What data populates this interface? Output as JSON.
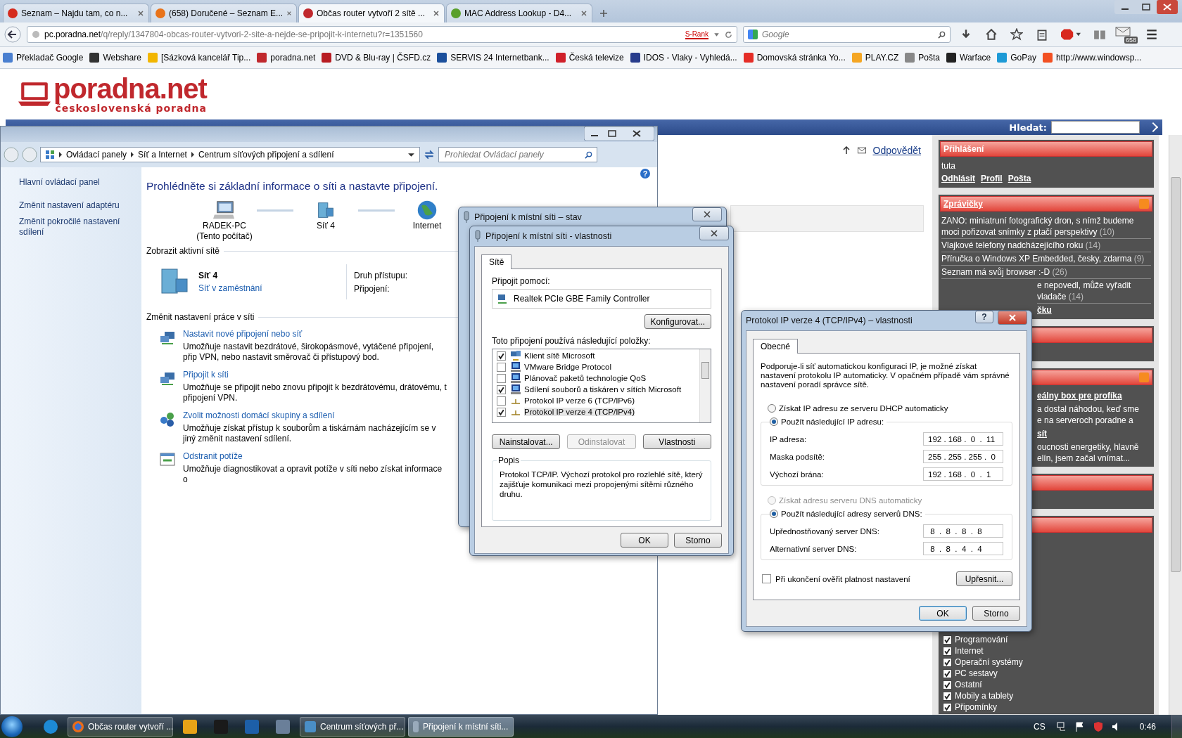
{
  "browser": {
    "tabs": [
      {
        "title": "Seznam – Najdu tam, co n...",
        "selected": false,
        "color": "#d52b1e"
      },
      {
        "title": "(658) Doručené – Seznam E...",
        "selected": false,
        "color": "#e8731a"
      },
      {
        "title": "Občas router vytvoří 2 sítě ...",
        "selected": true,
        "color": "#c0282d"
      },
      {
        "title": "MAC Address Lookup - D4...",
        "selected": false,
        "color": "#5aa02c"
      }
    ],
    "url_host": "pc.poradna.net",
    "url_path": "/q/reply/1347804-obcas-router-vytvori-2-site-a-nejde-se-pripojit-k-internetu?r=1351560",
    "rank": "S-Rank",
    "search_placeholder": "Google",
    "mail_count": "658",
    "bookmarks": [
      {
        "label": "Překladač Google",
        "color": "#4a7fd0"
      },
      {
        "label": "Webshare",
        "color": "#333333"
      },
      {
        "label": "[Sázková kancelář Tip...",
        "color": "#f2b600"
      },
      {
        "label": "poradna.net",
        "color": "#c0282d"
      },
      {
        "label": "DVD & Blu-ray | ČSFD.cz",
        "color": "#b81c22"
      },
      {
        "label": "SERVIS 24 Internetbank...",
        "color": "#1b4f9c"
      },
      {
        "label": "Česká televize",
        "color": "#d0202a"
      },
      {
        "label": "IDOS - Vlaky - Vyhledá...",
        "color": "#283c8c"
      },
      {
        "label": "Domovská stránka Yo...",
        "color": "#e52d27"
      },
      {
        "label": "PLAY.CZ",
        "color": "#f5a623"
      },
      {
        "label": "Pošta",
        "color": "#888888"
      },
      {
        "label": "Warface",
        "color": "#222222"
      },
      {
        "label": "GoPay",
        "color": "#1d9ad6"
      },
      {
        "label": "http://www.windowsp...",
        "color": "#f25022"
      }
    ]
  },
  "site": {
    "logo": "poradna.net",
    "tagline": "československá poradna",
    "search_label": "Hledat:",
    "reply_link": "Odpovědět"
  },
  "sidebar": {
    "login": {
      "title": "Přihlášení",
      "user": "tuta",
      "links": [
        "Odhlásit",
        "Profil",
        "Pošta"
      ]
    },
    "news": {
      "title": "Zprávičky",
      "items": [
        {
          "text": "ZANO: miniatruní fotografický dron, s nímž budeme moci pořizovat snímky z ptačí perspektivy",
          "count": "(10)",
          "partial": false
        },
        {
          "text": "Vlajkové telefony nadcházejícího roku",
          "count": "(14)",
          "partial": false
        },
        {
          "text": "Příručka o Windows XP Embedded, česky, zdarma",
          "count": "(9)",
          "partial": false
        },
        {
          "text": "Seznam má svůj browser :-D",
          "count": "(26)",
          "partial": false
        },
        {
          "text": "e nepovedl, může vyřadit vladače",
          "count": "(14)",
          "partial": true
        }
      ],
      "more": "čku"
    },
    "articles": {
      "items": [
        {
          "kind": "title",
          "text": "eálny box pre profíka"
        },
        {
          "kind": "text",
          "text": "a dostal náhodou, keď sme"
        },
        {
          "kind": "text",
          "text": "e na serveroch poradne a"
        },
        {
          "kind": "title",
          "text": "sít"
        },
        {
          "kind": "text",
          "text": "oucnosti energetiky, hlavně"
        },
        {
          "kind": "text",
          "text": "elín, jsem začal vnímat..."
        }
      ]
    },
    "categories": [
      {
        "label": "Programování",
        "checked": true
      },
      {
        "label": "Internet",
        "checked": true
      },
      {
        "label": "Operační systémy",
        "checked": true
      },
      {
        "label": "PC sestavy",
        "checked": true
      },
      {
        "label": "Ostatní",
        "checked": true
      },
      {
        "label": "Mobily a tablety",
        "checked": true
      },
      {
        "label": "Připomínky",
        "checked": true
      }
    ]
  },
  "control_panel": {
    "breadcrumb": [
      "Ovládací panely",
      "Síť a Internet",
      "Centrum síťových připojení a sdílení"
    ],
    "search_placeholder": "Prohledat Ovládací panely",
    "left_links": [
      "Hlavní ovládací panel",
      "Změnit nastavení adaptéru",
      "Změnit pokročilé nastavení sdílení"
    ],
    "help": "?",
    "heading": "Prohlédněte si základní informace o síti a nastavte připojení.",
    "map": [
      {
        "kind": "computer",
        "label": "RADEK-PC",
        "sub": "(Tento počítač)"
      },
      {
        "kind": "network",
        "label": "Síť  4"
      },
      {
        "kind": "globe",
        "label": "Internet"
      }
    ],
    "active_title": "Zobrazit aktivní sítě",
    "network_name": "Síť  4",
    "network_type": "Síť v zaměstnání",
    "access_label": "Druh přístupu:",
    "connection_label": "Připojení:",
    "change_title": "Změnit nastavení práce v síti",
    "tasks": [
      {
        "kind": "setup",
        "title": "Nastavit nové připojení nebo síť",
        "desc": "Umožňuje nastavit bezdrátové, širokopásmové, vytáčené připojení, přip VPN, nebo nastavit směrovač či přístupový bod."
      },
      {
        "kind": "connect",
        "title": "Připojit k síti",
        "desc": "Umožňuje se připojit nebo znovu připojit k bezdrátovému, drátovému, t připojení VPN."
      },
      {
        "kind": "homegroup",
        "title": "Zvolit možnosti domácí skupiny a sdílení",
        "desc": "Umožňuje získat přístup k souborům a tiskárnám nacházejícím se v jiný změnit nastavení sdílení."
      },
      {
        "kind": "troubleshoot",
        "title": "Odstranit potíže",
        "desc": "Umožňuje diagnostikovat a opravit potíže v síti nebo získat informace o"
      }
    ]
  },
  "status_dialog": {
    "title": "Připojení k místní síti – stav"
  },
  "properties_dialog": {
    "title": "Připojení k místní síti - vlastnosti",
    "tab": "Sítě",
    "connect_label": "Připojit pomocí:",
    "adapter": "Realtek PCIe GBE Family Controller",
    "configure": "Konfigurovat...",
    "items_label": "Toto připojení používá následující položky:",
    "items": [
      {
        "kind": "client",
        "label": "Klient sítě Microsoft",
        "checked": true,
        "selected": false
      },
      {
        "kind": "service",
        "label": "VMware Bridge Protocol",
        "checked": false,
        "selected": false
      },
      {
        "kind": "service",
        "label": "Plánovač paketů technologie QoS",
        "checked": false,
        "selected": false
      },
      {
        "kind": "service",
        "label": "Sdílení souborů a tiskáren v sítích Microsoft",
        "checked": true,
        "selected": false
      },
      {
        "kind": "protocol",
        "label": "Protokol IP verze 6 (TCP/IPv6)",
        "checked": false,
        "selected": false
      },
      {
        "kind": "protocol",
        "label": "Protokol IP verze 4 (TCP/IPv4)",
        "checked": true,
        "selected": true
      }
    ],
    "buttons": [
      {
        "label": "Nainstalovat...",
        "disabled": false
      },
      {
        "label": "Odinstalovat",
        "disabled": true
      },
      {
        "label": "Vlastnosti",
        "disabled": false
      }
    ],
    "desc_title": "Popis",
    "desc": "Protokol TCP/IP. Výchozí protokol pro rozlehlé sítě, který zajišťuje komunikaci mezi propojenými sítěmi různého druhu.",
    "ok": "OK",
    "cancel": "Storno"
  },
  "ipv4_dialog": {
    "title": "Protokol IP verze 4 (TCP/IPv4) – vlastnosti",
    "help": "?",
    "tab": "Obecné",
    "intro": "Podporuje-li síť automatickou konfiguraci IP, je možné získat nastavení protokolu IP automaticky. V opačném případě vám správné nastavení poradí správce sítě.",
    "ip_auto": {
      "label": "Získat IP adresu ze serveru DHCP automaticky",
      "selected": false,
      "disabled": false
    },
    "ip_manual": {
      "label": "Použít následující IP adresu:",
      "selected": true,
      "disabled": false
    },
    "ip_fields": [
      {
        "label": "IP adresa:",
        "value": "192 . 168 .  0  .  11"
      },
      {
        "label": "Maska podsítě:",
        "value": "255 . 255 . 255 .  0"
      },
      {
        "label": "Výchozí brána:",
        "value": "192 . 168 .  0  .  1"
      }
    ],
    "dns_auto": {
      "label": "Získat adresu serveru DNS automaticky",
      "selected": false,
      "disabled": true
    },
    "dns_manual": {
      "label": "Použít následující adresy serverů DNS:",
      "selected": true,
      "disabled": false
    },
    "dns_fields": [
      {
        "label": "Upřednostňovaný server DNS:",
        "value": " 8  .  8  .  8  .  8"
      },
      {
        "label": "Alternativní server DNS:",
        "value": " 8  .  8  .  4  .  4"
      }
    ],
    "validate": {
      "label": "Při ukončení ověřit platnost nastavení",
      "checked": false
    },
    "advanced": "Upřesnit...",
    "ok": "OK",
    "cancel": "Storno"
  },
  "taskbar": {
    "items": [
      {
        "kind": "ie",
        "selected": false
      },
      {
        "kind": "firefox",
        "label": "Občas router vytvoří ...",
        "selected": false
      },
      {
        "kind": "app",
        "selected": false,
        "color": "#e8a317"
      },
      {
        "kind": "app",
        "selected": false,
        "color": "#1a1a1a"
      },
      {
        "kind": "app",
        "selected": false,
        "color": "#1d5fa8"
      },
      {
        "kind": "app",
        "selected": false,
        "color": "#6a7f99"
      },
      {
        "kind": "network",
        "label": "Centrum síťových př...",
        "selected": false
      },
      {
        "kind": "plug",
        "label": "Připojení k místní síti...",
        "selected": true
      }
    ],
    "lang": "CS",
    "clock": "0:46"
  }
}
